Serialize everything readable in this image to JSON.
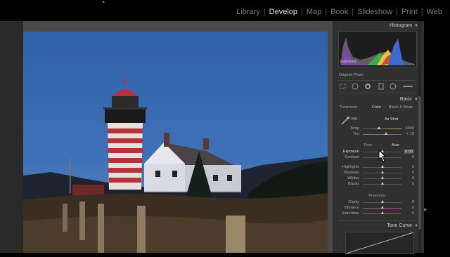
{
  "modules": [
    "Library",
    "Develop",
    "Map",
    "Book",
    "Slideshow",
    "Print",
    "Web"
  ],
  "active_module": "Develop",
  "histogram": {
    "title": "Histogram",
    "exposure_label": "Exposure",
    "original_photo_label": "Original Photo"
  },
  "basic": {
    "title": "Basic",
    "treatment_label": "Treatment :",
    "treatment_color": "Color",
    "treatment_bw": "Black & White",
    "wb_label": "WB :",
    "wb_value": "As Shot",
    "temp_label": "Temp",
    "temp_value": "5000",
    "tint_label": "Tint",
    "tint_value": "+ 10",
    "tone_label": "Tone",
    "auto_label": "Auto",
    "exposure_label": "Exposure",
    "exposure_value": "0.00",
    "contrast_label": "Contrast",
    "contrast_value": "0",
    "highlights_label": "Highlights",
    "highlights_value": "0",
    "shadows_label": "Shadows",
    "shadows_value": "0",
    "whites_label": "Whites",
    "whites_value": "0",
    "blacks_label": "Blacks",
    "blacks_value": "0",
    "presence_label": "Presence",
    "clarity_label": "Clarity",
    "clarity_value": "0",
    "vibrance_label": "Vibrance",
    "vibrance_value": "0",
    "saturation_label": "Saturation",
    "saturation_value": "0"
  },
  "tone_curve": {
    "title": "Tone Curve"
  },
  "colors": {
    "accent": "#e6e6e6",
    "panel": "#303030",
    "sky": "#3a6fb5"
  }
}
